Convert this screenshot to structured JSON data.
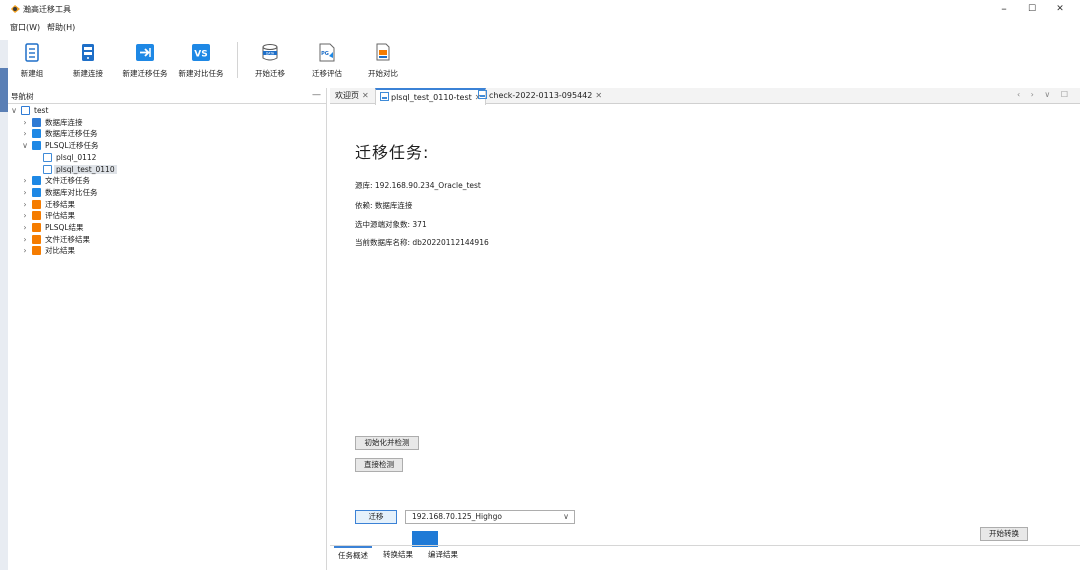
{
  "window": {
    "title": "瀚高迁移工具",
    "controls": {
      "minimize": "–",
      "maximize": "☐",
      "close": "✕"
    }
  },
  "menu": {
    "items": [
      "窗口(W)",
      "帮助(H)"
    ]
  },
  "toolbar": {
    "items": [
      {
        "label": "新建组",
        "icon": "new-group-icon"
      },
      {
        "label": "新建连接",
        "icon": "new-connection-icon"
      },
      {
        "label": "新建迁移任务",
        "icon": "new-migration-task-icon"
      },
      {
        "label": "新建对比任务",
        "icon": "new-compare-task-icon"
      },
      {
        "label": "开始迁移",
        "icon": "start-migration-icon"
      },
      {
        "label": "迁移评估",
        "icon": "migration-assessment-icon"
      },
      {
        "label": "开始对比",
        "icon": "start-compare-icon"
      }
    ]
  },
  "nav": {
    "title": "导航树",
    "min_icon": "—",
    "tree": [
      {
        "label": "test",
        "toggle": "∨",
        "icon_color": "#2f7bd5"
      },
      {
        "label": "数据库连接",
        "toggle": "›",
        "icon_color": "#2f7bd5"
      },
      {
        "label": "数据库迁移任务",
        "toggle": "›",
        "icon_color": "#1e88e5"
      },
      {
        "label": "PLSQL迁移任务",
        "toggle": "∨",
        "icon_color": "#1e88e5"
      },
      {
        "label": "plsql_0112",
        "toggle": "",
        "icon_color": "#3f8bd8"
      },
      {
        "label": "plsql_test_0110",
        "toggle": "",
        "icon_color": "#3f8bd8"
      },
      {
        "label": "文件迁移任务",
        "toggle": "›",
        "icon_color": "#1e88e5"
      },
      {
        "label": "数据库对比任务",
        "toggle": "›",
        "icon_color": "#1e88e5"
      },
      {
        "label": "迁移结果",
        "toggle": "›",
        "icon_color": "#f57c00"
      },
      {
        "label": "评估结果",
        "toggle": "›",
        "icon_color": "#f57c00"
      },
      {
        "label": "PLSQL结果",
        "toggle": "›",
        "icon_color": "#f57c00"
      },
      {
        "label": "文件迁移结果",
        "toggle": "›",
        "icon_color": "#f57c00"
      },
      {
        "label": "对比结果",
        "toggle": "›",
        "icon_color": "#f57c00"
      }
    ]
  },
  "editor": {
    "tabs": [
      {
        "label": "欢迎页",
        "close": "✕"
      },
      {
        "label": "plsql_test_0110-test",
        "close": "✕"
      },
      {
        "label": "check-2022-0113-095442",
        "close": "✕"
      }
    ],
    "tab_controls": "‹ › ∨ ☐",
    "heading": "迁移任务:",
    "info": {
      "source": "源库: 192.168.90.234_Oracle_test",
      "dependency": "依赖: 数据库连接",
      "selected_objects": "选中源端对象数: 371",
      "current_db": "当前数据库名称: db20220112144916"
    },
    "buttons": {
      "init_check": "初始化并检测",
      "direct_check": "直接检测",
      "migrate": "迁移",
      "start_convert": "开始转换"
    },
    "target_select": {
      "value": "192.168.70.125_Highgo",
      "chevron": "∨"
    },
    "bottom_tabs": [
      "任务概述",
      "转换结果",
      "编译结果"
    ]
  },
  "colors": {
    "accent": "#3b82d6",
    "progress": "#1f7ad6",
    "orange": "#f57c00"
  }
}
